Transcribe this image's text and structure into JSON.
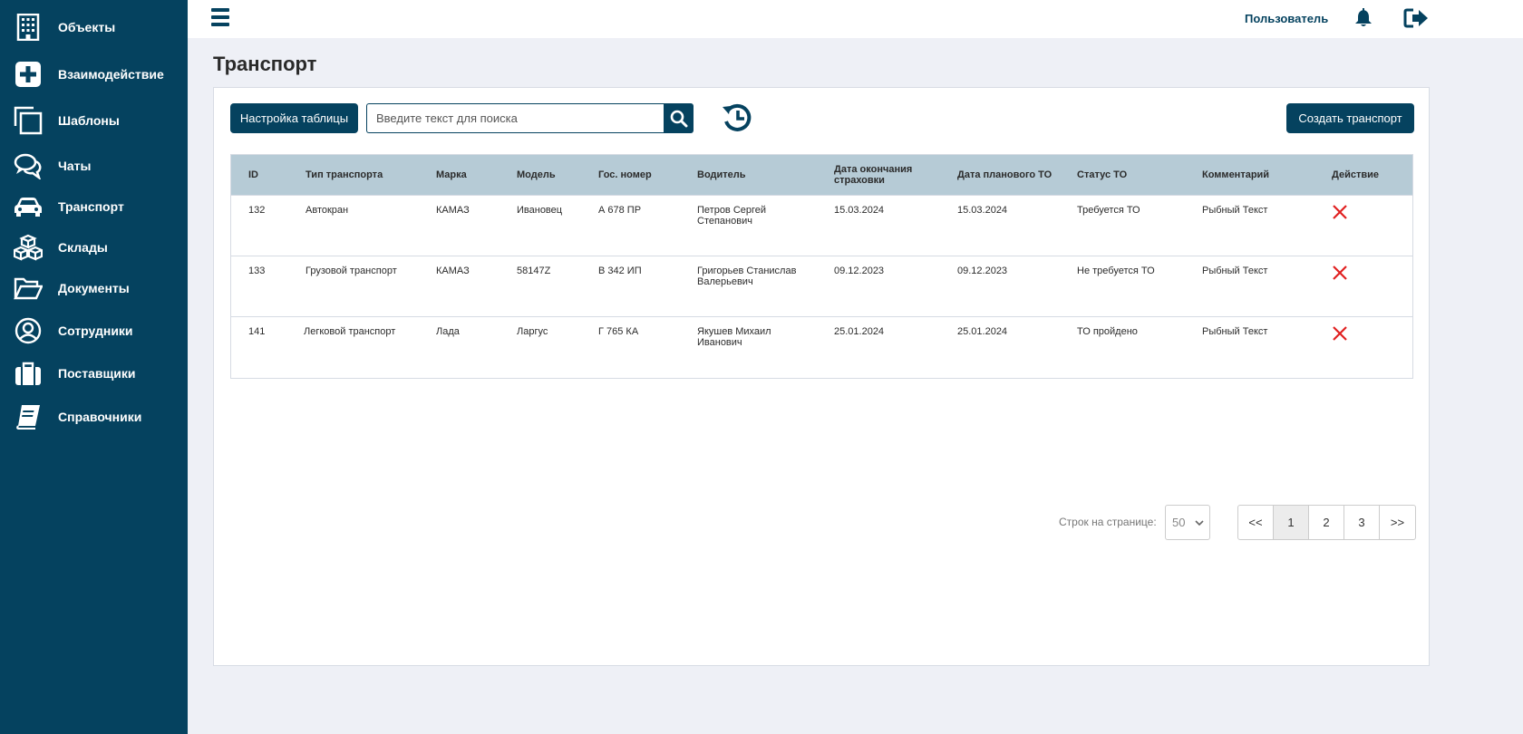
{
  "sidebar": {
    "items": [
      {
        "label": "Объекты",
        "icon": "building-icon"
      },
      {
        "label": "Взаимодействие",
        "icon": "plus-square-icon"
      },
      {
        "label": "Шаблоны",
        "icon": "copy-icon"
      },
      {
        "label": "Чаты",
        "icon": "chat-bubbles-icon"
      },
      {
        "label": "Транспорт",
        "icon": "car-icon"
      },
      {
        "label": "Склады",
        "icon": "boxes-icon"
      },
      {
        "label": "Документы",
        "icon": "folder-open-icon"
      },
      {
        "label": "Сотрудники",
        "icon": "user-circle-icon"
      },
      {
        "label": "Поставщики",
        "icon": "briefcase-icon"
      },
      {
        "label": "Справочники",
        "icon": "book-icon"
      }
    ]
  },
  "header": {
    "user_label": "Пользователь"
  },
  "page": {
    "title": "Транспорт"
  },
  "toolbar": {
    "settings_label": "Настройка таблицы",
    "search_placeholder": "Введите текст для поиска",
    "create_label": "Создать транспорт"
  },
  "table": {
    "columns": [
      "ID",
      "Тип транспорта",
      "Марка",
      "Модель",
      "Гос. номер",
      "Водитель",
      "Дата окончания страховки",
      "Дата планового ТО",
      "Статус ТО",
      "Комментарий",
      "Действие"
    ],
    "rows": [
      {
        "id": "132",
        "type": "Автокран",
        "brand": "КАМАЗ",
        "model": "Ивановец",
        "plate": "А 678 ПР",
        "driver": "Петров Сергей Степанович",
        "insurance": "15.03.2024",
        "maintenance": "15.03.2024",
        "status": "Требуется ТО",
        "comment": "Рыбный Текст"
      },
      {
        "id": "133",
        "type": "Грузовой транспорт",
        "brand": "КАМАЗ",
        "model": "58147Z",
        "plate": "В 342 ИП",
        "driver": "Григорьев Станислав Валерьевич",
        "insurance": "09.12.2023",
        "maintenance": "09.12.2023",
        "status": "Не требуется ТО",
        "comment": "Рыбный Текст"
      },
      {
        "id": "141",
        "type": "Легковой транспорт",
        "brand": "Лада",
        "model": "Ларгус",
        "plate": "Г 765 КА",
        "driver": "Якушев Михаил Иванович",
        "insurance": "25.01.2024",
        "maintenance": "25.01.2024",
        "status": "ТО пройдено",
        "comment": "Рыбный Текст"
      }
    ]
  },
  "pagination": {
    "rows_label": "Строк на странице:",
    "rows_per_page": "50",
    "prev": "<<",
    "pages": [
      "1",
      "2",
      "3"
    ],
    "current_page": "1",
    "next": ">>"
  },
  "colors": {
    "primary": "#05425f",
    "table_header": "#b6cbd6",
    "delete": "#e02020",
    "background": "#eef0f6"
  }
}
